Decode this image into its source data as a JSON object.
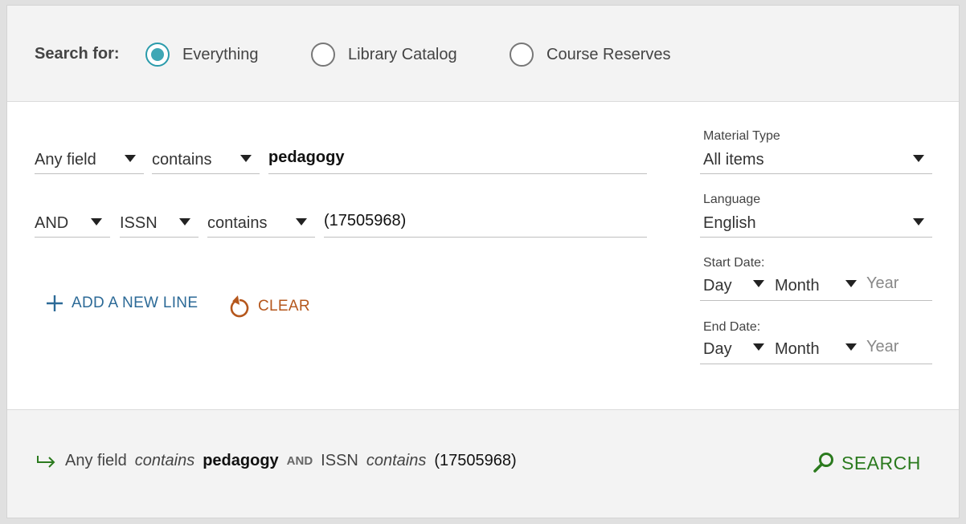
{
  "scope": {
    "label": "Search for:",
    "options": [
      {
        "label": "Everything",
        "selected": true
      },
      {
        "label": "Library Catalog",
        "selected": false
      },
      {
        "label": "Course Reserves",
        "selected": false
      }
    ]
  },
  "query": {
    "line1": {
      "field": "Any field",
      "operator": "contains",
      "value": "pedagogy"
    },
    "line2": {
      "boolean": "AND",
      "field": "ISSN",
      "operator": "contains",
      "value": "(17505968)"
    }
  },
  "actions": {
    "add_line": "ADD A NEW LINE",
    "clear": "CLEAR"
  },
  "filters": {
    "material_type": {
      "label": "Material Type",
      "value": "All items"
    },
    "language": {
      "label": "Language",
      "value": "English"
    },
    "start_date": {
      "label": "Start Date:",
      "day": "Day",
      "month": "Month",
      "year": "Year"
    },
    "end_date": {
      "label": "End Date:",
      "day": "Day",
      "month": "Month",
      "year": "Year"
    }
  },
  "summary": {
    "field1": "Any field",
    "op1": "contains",
    "value1": "pedagogy",
    "boolean": "AND",
    "field2": "ISSN",
    "op2": "contains",
    "value2": "(17505968)"
  },
  "search_button": "SEARCH",
  "colors": {
    "accent_teal": "#3fa7b5",
    "link_blue": "#2c6a97",
    "clear_orange": "#b5571c",
    "search_green": "#2b7a1e"
  },
  "icons": [
    "radio-selected-icon",
    "plus-icon",
    "refresh-icon",
    "arrow-right-icon",
    "search-icon"
  ]
}
